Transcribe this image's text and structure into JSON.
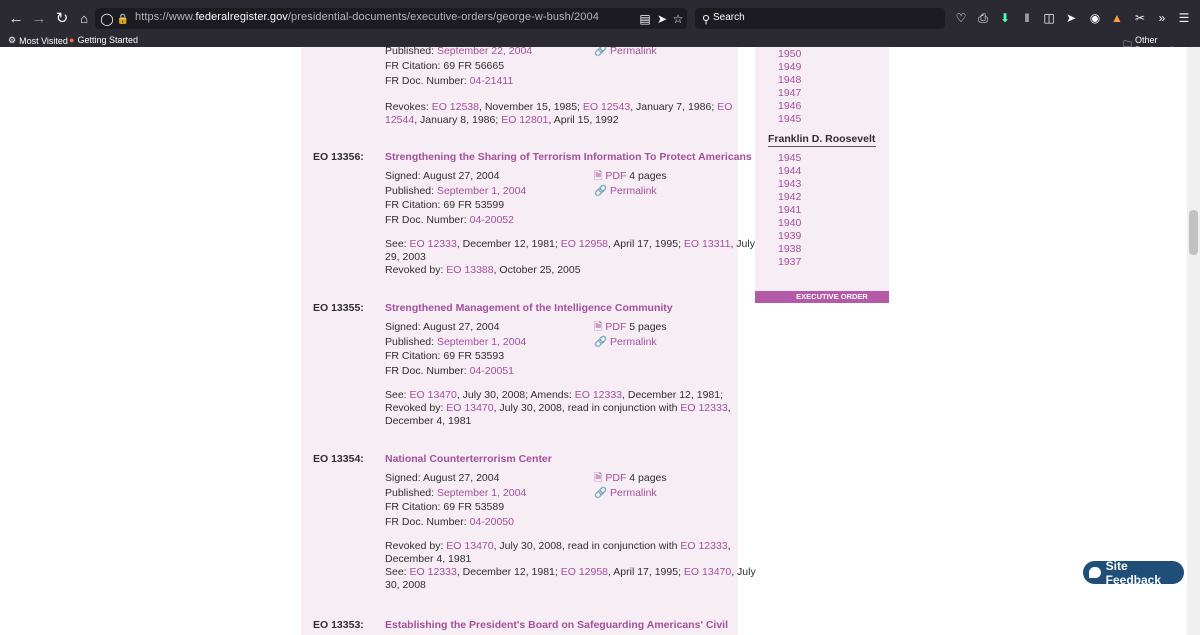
{
  "browser": {
    "url_prefix": "https://www.",
    "url_domain": "federalregister.gov",
    "url_path": "/presidential-documents/executive-orders/george-w-bush/2004",
    "search_placeholder": "Search",
    "bookmarks": [
      "Most Visited",
      "Getting Started"
    ],
    "other_bookmarks": "Other Bookmarks"
  },
  "eo_prev": {
    "published_label": "Published:",
    "published_date": "September 22, 2004",
    "permalink": "Permalink",
    "fr_citation_label": "FR Citation:",
    "fr_citation": "69 FR 56665",
    "fr_doc_label": "FR Doc. Number:",
    "fr_doc": "04-21411",
    "revokes_label": "Revokes:",
    "revokes_line1": [
      {
        "link": "EO 12538",
        "text": ", November 15, 1985; "
      },
      {
        "link": "EO 12543",
        "text": ", January 7, 1986; "
      },
      {
        "link": "EO",
        "text": ""
      }
    ],
    "revokes_line2": [
      {
        "link": "12544",
        "text": ", January 8, 1986; "
      },
      {
        "link": "EO 12801",
        "text": ", April 15, 1992"
      }
    ]
  },
  "orders": [
    {
      "number": "EO 13356:",
      "title": "Strengthening the Sharing of Terrorism Information To Protect Americans",
      "signed_label": "Signed:",
      "signed": "August 27, 2004",
      "published_label": "Published:",
      "published": "September 1, 2004",
      "pdf": "PDF",
      "pages": "4 pages",
      "permalink": "Permalink",
      "fr_citation_label": "FR Citation:",
      "fr_citation": "69 FR 53599",
      "fr_doc_label": "FR Doc. Number:",
      "fr_doc": "04-20052",
      "notes": [
        [
          {
            "text": "See: "
          },
          {
            "link": "EO 12333"
          },
          {
            "text": ", December 12, 1981; "
          },
          {
            "link": "EO 12958"
          },
          {
            "text": ", April 17, 1995; "
          },
          {
            "link": "EO 13311"
          },
          {
            "text": ", July"
          }
        ],
        [
          {
            "text": "29, 2003"
          }
        ],
        [
          {
            "text": "Revoked by: "
          },
          {
            "link": "EO 13388"
          },
          {
            "text": ", October 25, 2005"
          }
        ]
      ]
    },
    {
      "number": "EO 13355:",
      "title": "Strengthened Management of the Intelligence Community",
      "signed_label": "Signed:",
      "signed": "August 27, 2004",
      "published_label": "Published:",
      "published": "September 1, 2004",
      "pdf": "PDF",
      "pages": "5 pages",
      "permalink": "Permalink",
      "fr_citation_label": "FR Citation:",
      "fr_citation": "69 FR 53593",
      "fr_doc_label": "FR Doc. Number:",
      "fr_doc": "04-20051",
      "notes": [
        [
          {
            "text": "See: "
          },
          {
            "link": "EO 13470"
          },
          {
            "text": ", July 30, 2008; Amends: "
          },
          {
            "link": "EO 12333"
          },
          {
            "text": ", December 12, 1981;"
          }
        ],
        [
          {
            "text": "Revoked by: "
          },
          {
            "link": "EO 13470"
          },
          {
            "text": ", July 30, 2008, read in conjunction with "
          },
          {
            "link": "EO 12333"
          },
          {
            "text": ","
          }
        ],
        [
          {
            "text": "December 4, 1981"
          }
        ]
      ]
    },
    {
      "number": "EO 13354:",
      "title": "National Counterterrorism Center",
      "signed_label": "Signed:",
      "signed": "August 27, 2004",
      "published_label": "Published:",
      "published": "September 1, 2004",
      "pdf": "PDF",
      "pages": "4 pages",
      "permalink": "Permalink",
      "fr_citation_label": "FR Citation:",
      "fr_citation": "69 FR 53589",
      "fr_doc_label": "FR Doc. Number:",
      "fr_doc": "04-20050",
      "notes": [
        [
          {
            "text": "Revoked by: "
          },
          {
            "link": "EO 13470"
          },
          {
            "text": ", July 30, 2008, read in conjunction with "
          },
          {
            "link": "EO 12333"
          },
          {
            "text": ","
          }
        ],
        [
          {
            "text": "December 4, 1981"
          }
        ],
        [
          {
            "text": "See: "
          },
          {
            "link": "EO 12333"
          },
          {
            "text": ", December 12, 1981; "
          },
          {
            "link": "EO 12958"
          },
          {
            "text": ", April 17, 1995; "
          },
          {
            "link": "EO 13470"
          },
          {
            "text": ", July"
          }
        ],
        [
          {
            "text": "30, 2008"
          }
        ]
      ]
    }
  ],
  "eo_next": {
    "number": "EO 13353:",
    "title": "Establishing the President's Board on Safeguarding Americans' Civil"
  },
  "sidebar": {
    "years_top": [
      "1950",
      "1949",
      "1948",
      "1947",
      "1946",
      "1945"
    ],
    "president": "Franklin D. Roosevelt",
    "years_fdr": [
      "1945",
      "1944",
      "1943",
      "1942",
      "1941",
      "1940",
      "1939",
      "1938",
      "1937"
    ],
    "tab_label": "EXECUTIVE ORDER"
  },
  "feedback": "Site Feedback"
}
